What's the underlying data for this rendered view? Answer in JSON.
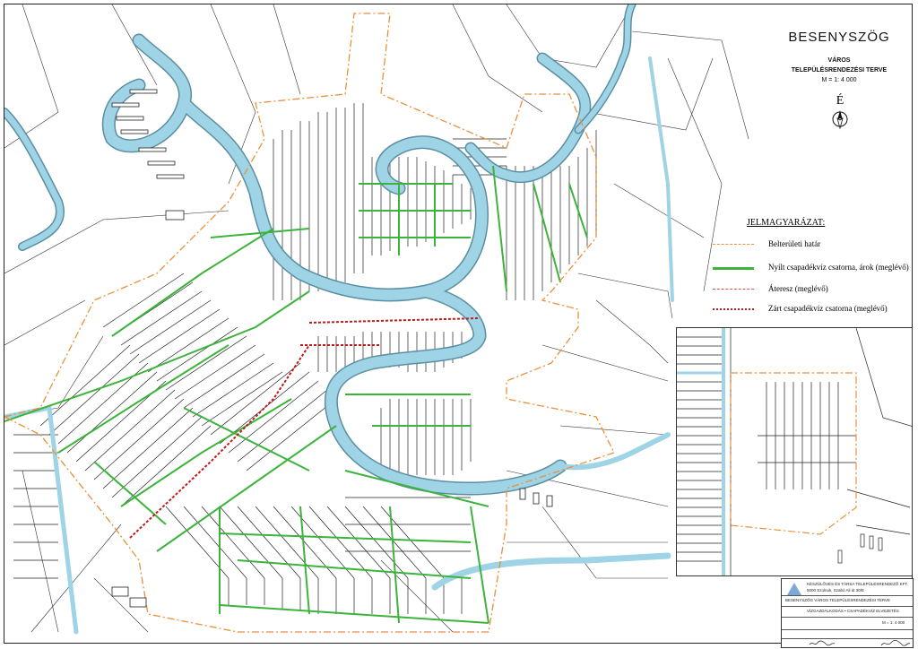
{
  "title_block": {
    "name": "BESENYSZÖG",
    "type": "VÁROS",
    "plan": "TELEPÜLÉSRENDEZÉSI TERVE",
    "scale": "M = 1: 4 000",
    "north_letter": "É"
  },
  "legend": {
    "title": "JELMAGYARÁZAT:",
    "items": [
      {
        "label": "Belterületi határ",
        "color": "#e8913a",
        "style": "dashdot"
      },
      {
        "label": "Nyílt csapadékvíz csatorna, árok (meglévő)",
        "color": "#3cb43c",
        "style": "solid"
      },
      {
        "label": "Áteresz (meglévő)",
        "color": "#e05050",
        "style": "dashed"
      },
      {
        "label": "Zárt csapadékvíz csatorna (meglévő)",
        "color": "#c01a1a",
        "style": "dotted"
      }
    ]
  },
  "stamp": {
    "company": "KÉSZÜLŐVÉS ÉS TÁRSA TELEPÜLÉSRENDEZŐ KFT.",
    "address": "5000 Szolnok, Szabó Ali út 30/E",
    "project": "BESENYSZÖG VÁROS TELEPÜLÉSRENDEZÉSI TERVE",
    "sheet": "VÍZGAZDÁLKODÁS • CSAPADÉKVÍZ ELVEZETÉS",
    "scale_cell": "M = 1: 4 000"
  },
  "colors": {
    "river": "#9fd3e6",
    "river_edge": "#5a8ea0",
    "drain": "#3cb43c",
    "boundary": "#e8913a",
    "closed_sewer": "#c01a1a",
    "parcel_line": "#222222"
  }
}
